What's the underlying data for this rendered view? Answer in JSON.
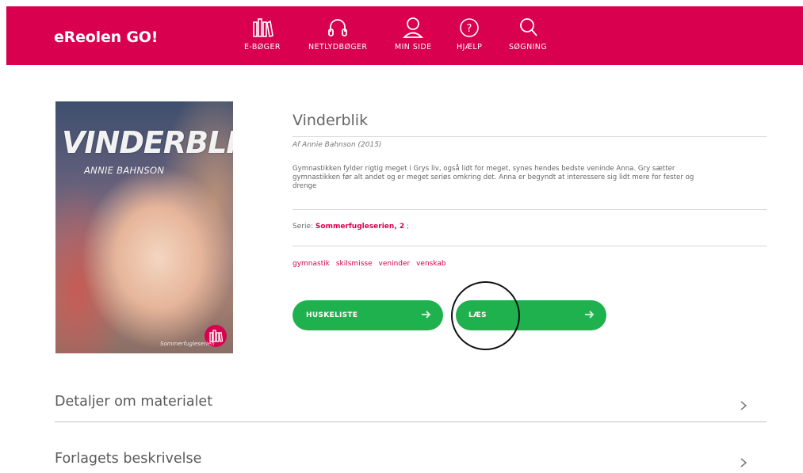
{
  "header": {
    "logo": "eReolen GO!",
    "brand_color": "#d8004f",
    "nav": [
      {
        "label": "E-BØGER",
        "icon": "books-icon"
      },
      {
        "label": "NETLYDBØGER",
        "icon": "headphones-icon"
      },
      {
        "label": "MIN SIDE",
        "icon": "user-icon"
      },
      {
        "label": "HJÆLP",
        "icon": "help-icon"
      },
      {
        "label": "SØGNING",
        "icon": "search-icon"
      }
    ]
  },
  "cover": {
    "title": "VINDERBLIK",
    "author": "ANNIE BAHNSON",
    "series_mark": "Sommerfugleserien"
  },
  "book": {
    "title": "Vinderblik",
    "byline": "Af Annie Bahnson (2015)",
    "description": "Gymnastikken fylder rigtig meget i Grys liv, også lidt for meget, synes hendes bedste veninde Anna. Gry sætter gymnastikken før alt andet og er meget seriøs omkring det. Anna er begyndt at interessere sig lidt mere for fester og drenge",
    "series_prefix": "Serie:",
    "series_link": "Sommerfugleserien, 2",
    "series_suffix": ";",
    "subjects": [
      "gymnastik",
      "skilsmisse",
      "veninder",
      "venskab"
    ]
  },
  "actions": {
    "wishlist_label": "HUSKELISTE",
    "read_label": "LÆS",
    "button_color": "#1fb14e"
  },
  "accordion": [
    {
      "label": "Detaljer om materialet"
    },
    {
      "label": "Forlagets beskrivelse"
    }
  ]
}
